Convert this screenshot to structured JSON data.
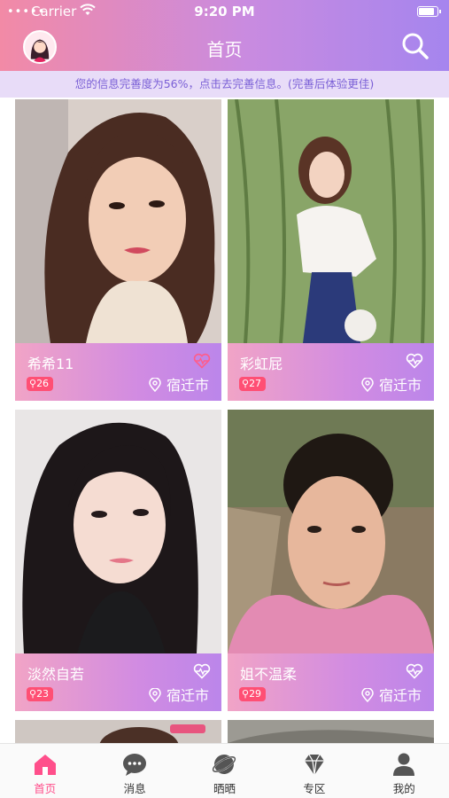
{
  "status_bar": {
    "carrier": "Carrier",
    "time": "9:20 PM",
    "battery": 0.92
  },
  "header": {
    "title": "首页",
    "avatar_icon": "user-avatar",
    "search_icon": "search-icon"
  },
  "notice": {
    "text": "您的信息完善度为56%，点击去完善信息。(完善后体验更佳)"
  },
  "profiles": [
    {
      "name": "希希11",
      "age": "26",
      "city": "宿迁市",
      "liked": true
    },
    {
      "name": "彩虹屁",
      "age": "27",
      "city": "宿迁市",
      "liked": false
    },
    {
      "name": "淡然自若",
      "age": "23",
      "city": "宿迁市",
      "liked": false
    },
    {
      "name": "姐不温柔",
      "age": "29",
      "city": "宿迁市",
      "liked": false
    }
  ],
  "tabs": [
    {
      "label": "首页",
      "icon": "home-icon",
      "active": true
    },
    {
      "label": "消息",
      "icon": "chat-icon",
      "active": false
    },
    {
      "label": "晒晒",
      "icon": "planet-icon",
      "active": false
    },
    {
      "label": "专区",
      "icon": "diamond-icon",
      "active": false
    },
    {
      "label": "我的",
      "icon": "person-icon",
      "active": false
    }
  ],
  "colors": {
    "accent": "#ff4f8b",
    "header_start": "#f28aa6",
    "header_end": "#a585ee",
    "age_badge": "#ff4f74"
  }
}
